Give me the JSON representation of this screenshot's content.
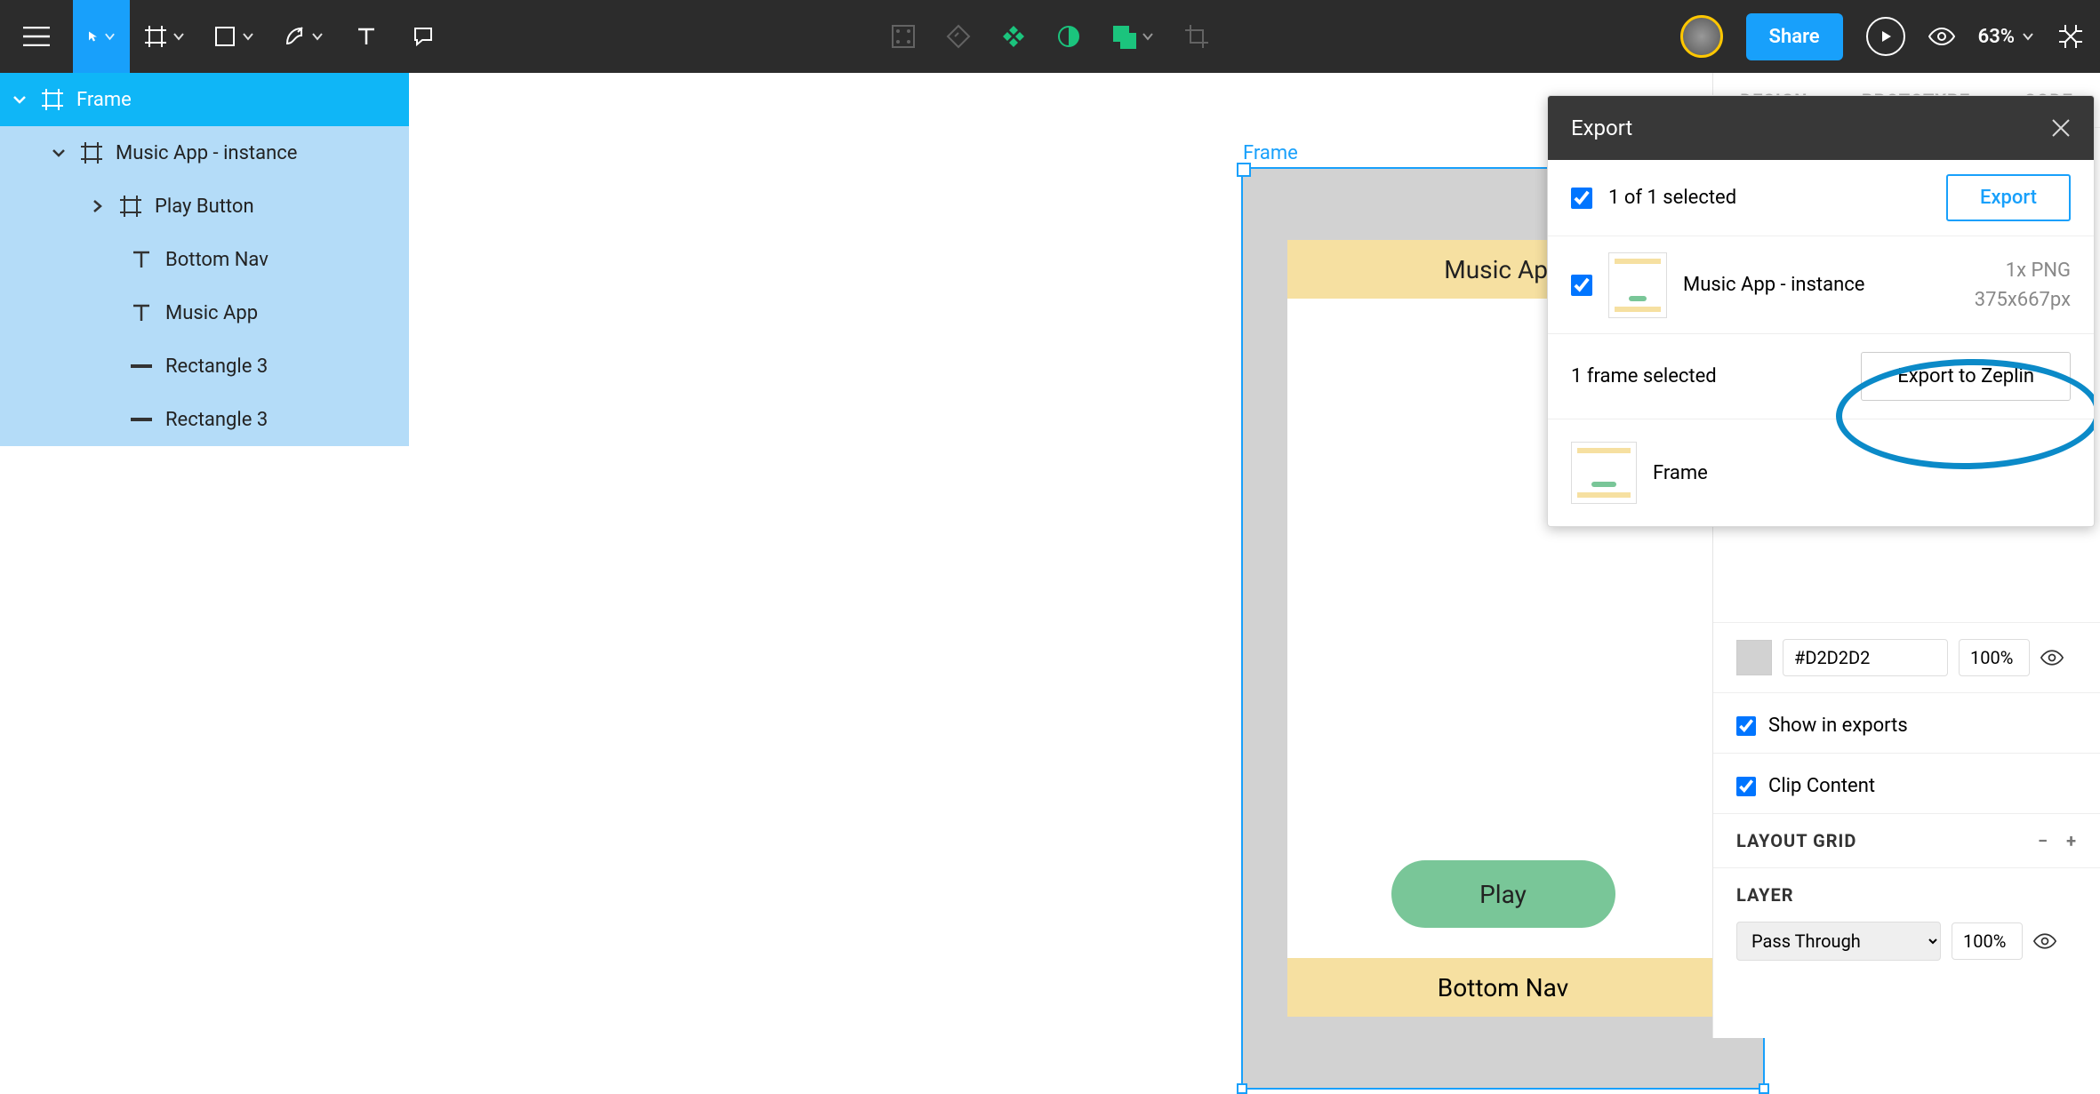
{
  "topbar": {
    "share_label": "Share",
    "zoom": "63%"
  },
  "inspector_tabs": {
    "design": "DESIGN",
    "prototype": "PROTOTYPE",
    "code": "CODE"
  },
  "layers": {
    "root": "Frame",
    "items": [
      "Music App - instance",
      "Play Button",
      "Bottom Nav",
      "Music App",
      "Rectangle 3",
      "Rectangle 3"
    ]
  },
  "canvas": {
    "frame_label": "Frame",
    "app_title": "Music App",
    "play_label": "Play",
    "footer_label": "Bottom Nav"
  },
  "export_panel": {
    "title": "Export",
    "selected_summary": "1 of 1 selected",
    "export_btn": "Export",
    "item_name": "Music App - instance",
    "item_scale": "1x PNG",
    "item_size": "375x667px",
    "frames_selected": "1 frame selected",
    "zeplin_btn": "Export to Zeplin",
    "frame_item": "Frame"
  },
  "inspector": {
    "fill_hex": "#D2D2D2",
    "fill_opacity": "100%",
    "show_exports": "Show in exports",
    "clip_content": "Clip Content",
    "layout_grid": "LAYOUT GRID",
    "layer": "LAYER",
    "blend_mode": "Pass Through",
    "layer_opacity": "100%"
  }
}
